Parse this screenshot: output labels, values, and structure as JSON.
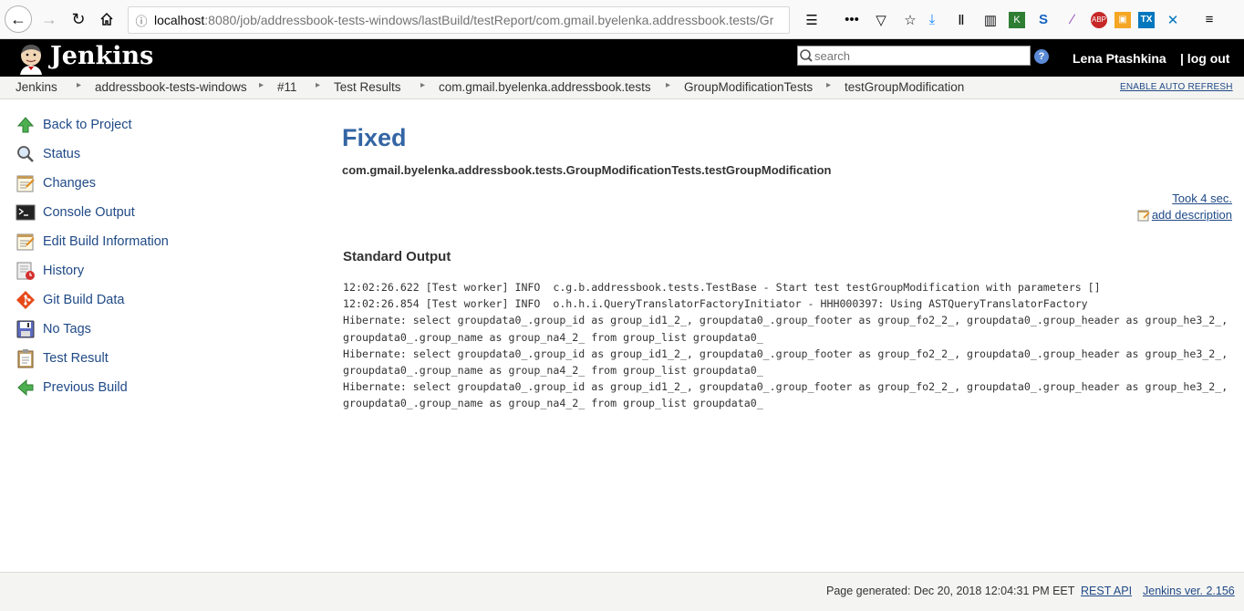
{
  "browser": {
    "url_host": "localhost",
    "url_rest": ":8080/job/addressbook-tests-windows/lastBuild/testReport/com.gmail.byelenka.addressbook.tests/Gr"
  },
  "header": {
    "logo_text": "Jenkins",
    "search_placeholder": "search",
    "user": "Lena Ptashkina",
    "logout": "| log out"
  },
  "breadcrumbs": {
    "items": [
      "Jenkins",
      "addressbook-tests-windows",
      "#11",
      "Test Results",
      "com.gmail.byelenka.addressbook.tests",
      "GroupModificationTests",
      "testGroupModification"
    ],
    "auto_refresh": "ENABLE AUTO REFRESH"
  },
  "sidebar": {
    "items": [
      {
        "label": "Back to Project",
        "icon": "up-arrow-icon"
      },
      {
        "label": "Status",
        "icon": "magnifier-icon"
      },
      {
        "label": "Changes",
        "icon": "notepad-icon"
      },
      {
        "label": "Console Output",
        "icon": "terminal-icon"
      },
      {
        "label": "Edit Build Information",
        "icon": "notepad-icon"
      },
      {
        "label": "History",
        "icon": "history-icon"
      },
      {
        "label": "Git Build Data",
        "icon": "git-icon"
      },
      {
        "label": "No Tags",
        "icon": "save-icon"
      },
      {
        "label": "Test Result",
        "icon": "clipboard-icon"
      },
      {
        "label": "Previous Build",
        "icon": "left-arrow-icon"
      }
    ]
  },
  "main": {
    "status": "Fixed",
    "test_name": "com.gmail.byelenka.addressbook.tests.GroupModificationTests.testGroupModification",
    "took": "Took 4 sec.",
    "add_description": "add description",
    "stdout_title": "Standard Output",
    "stdout_lines": [
      "12:02:26.622 [Test worker] INFO  c.g.b.addressbook.tests.TestBase - Start test testGroupModification with parameters []",
      "12:02:26.854 [Test worker] INFO  o.h.h.i.QueryTranslatorFactoryInitiator - HHH000397: Using ASTQueryTranslatorFactory",
      "Hibernate: select groupdata0_.group_id as group_id1_2_, groupdata0_.group_footer as group_fo2_2_, groupdata0_.group_header as group_he3_2_, groupdata0_.group_name as group_na4_2_ from group_list groupdata0_",
      "Hibernate: select groupdata0_.group_id as group_id1_2_, groupdata0_.group_footer as group_fo2_2_, groupdata0_.group_header as group_he3_2_, groupdata0_.group_name as group_na4_2_ from group_list groupdata0_",
      "Hibernate: select groupdata0_.group_id as group_id1_2_, groupdata0_.group_footer as group_fo2_2_, groupdata0_.group_header as group_he3_2_, groupdata0_.group_name as group_na4_2_ from group_list groupdata0_"
    ]
  },
  "footer": {
    "page_generated": "Page generated: Dec 20, 2018 12:04:31 PM EET",
    "rest_api": "REST API",
    "version": "Jenkins ver. 2.156"
  }
}
